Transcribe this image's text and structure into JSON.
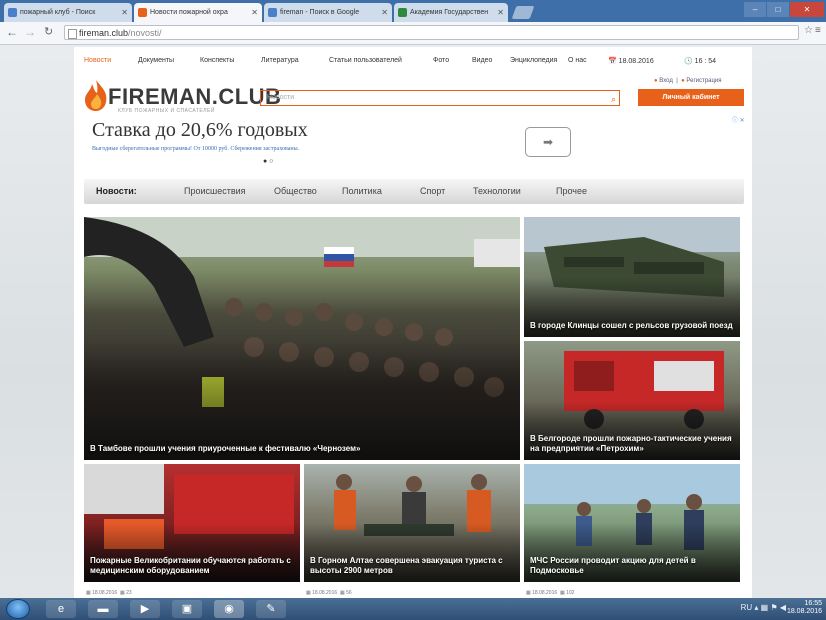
{
  "browser": {
    "tabs": [
      {
        "label": "пожарный клуб - Поиск",
        "active": false,
        "icon_color": "#4a80c8"
      },
      {
        "label": "Новости пожарной охра",
        "active": true,
        "icon_color": "#e8611a"
      },
      {
        "label": "fireman - Поиск в Google",
        "active": false,
        "icon_color": "#4a80c8"
      },
      {
        "label": "Академия Государствен",
        "active": false,
        "icon_color": "#2d8a3e"
      }
    ],
    "url_host": "fireman.club",
    "url_path": "/novosti/",
    "window_buttons": [
      "–",
      "□",
      "✕"
    ]
  },
  "site": {
    "topnav": [
      "Новости",
      "Документы",
      "Конспекты",
      "Литература",
      "Статьи пользователей",
      "Фото",
      "Видео",
      "Энциклопедия",
      "О нас"
    ],
    "date": "18.08.2016",
    "time": "16 : 54",
    "logo_text": "FIREMAN.CLUB",
    "logo_tagline": "КЛУБ ПОЖАРНЫХ И СПАСАТЕЛЕЙ",
    "search_placeholder": "Новости",
    "login_label": "Вход",
    "register_label": "Регистрация",
    "cabinet_label": "Личный кабинет",
    "ad": {
      "title": "Ставка до 20,6% годовых",
      "subtitle": "Выгодные сберегательные программы! От 10000 руб. Сбережения застрахованы.",
      "dots": "● ○",
      "arrow": "➡",
      "choice": "ⓘ ✕"
    },
    "categories": [
      "Новости:",
      "Происшествия",
      "Общество",
      "Политика",
      "Спорт",
      "Технологии",
      "Прочее"
    ],
    "news": [
      {
        "caption": "В Тамбове прошли учения приуроченные к фестивалю «Чернозем»"
      },
      {
        "caption": "В городе Клинцы сошел с рельсов грузовой поезд"
      },
      {
        "caption": "В Белгороде прошли пожарно-тактические учения на предприятии «Петрохим»"
      },
      {
        "caption": "Пожарные Великобритании обучаются работать с медицинским оборудованием",
        "date": "18.08.2016",
        "views": "23"
      },
      {
        "caption": "В Горном Алтае совершена эвакуация туриста с высоты 2900 метров",
        "date": "18.08.2016",
        "views": "56"
      },
      {
        "caption": "МЧС России проводит акцию для детей в Подмосковье",
        "date": "18.08.2016",
        "views": "102"
      }
    ]
  },
  "taskbar": {
    "lang": "RU",
    "time": "16:55",
    "date": "18.08.2016"
  }
}
